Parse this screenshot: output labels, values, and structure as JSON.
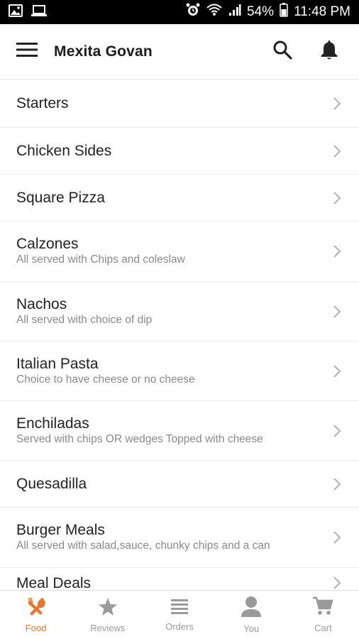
{
  "status_bar": {
    "battery": "54%",
    "time": "11:48 PM"
  },
  "app_bar": {
    "title": "Mexita Govan"
  },
  "menu_items": [
    {
      "title": "Starters",
      "subtitle": ""
    },
    {
      "title": "Chicken Sides",
      "subtitle": ""
    },
    {
      "title": "Square Pizza",
      "subtitle": ""
    },
    {
      "title": "Calzones",
      "subtitle": "All served with Chips and coleslaw"
    },
    {
      "title": "Nachos",
      "subtitle": "All served with choice of dip"
    },
    {
      "title": "Italian Pasta",
      "subtitle": "Choice to have cheese or no cheese"
    },
    {
      "title": "Enchiladas",
      "subtitle": "Served with chips OR wedges Topped with cheese"
    },
    {
      "title": "Quesadilla",
      "subtitle": ""
    },
    {
      "title": "Burger Meals",
      "subtitle": "All served with salad,sauce, chunky chips and a can"
    },
    {
      "title": "Meal Deals",
      "subtitle": ""
    }
  ],
  "bottom_nav": [
    {
      "label": "Food",
      "icon": "fork-knife-icon",
      "active": true
    },
    {
      "label": "Reviews",
      "icon": "star-icon",
      "active": false
    },
    {
      "label": "Orders",
      "icon": "list-icon",
      "active": false
    },
    {
      "label": "You",
      "icon": "person-icon",
      "active": false
    },
    {
      "label": "Cart",
      "icon": "cart-icon",
      "active": false
    }
  ],
  "colors": {
    "accent": "#e8762b",
    "inactive": "#9a9a9a"
  }
}
